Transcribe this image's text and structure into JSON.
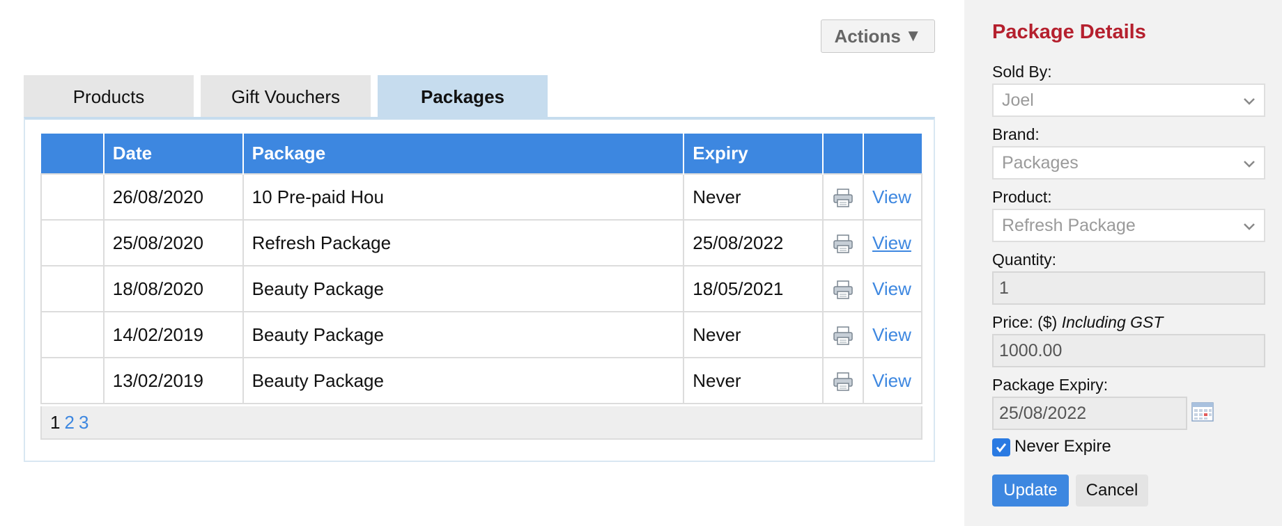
{
  "actions": {
    "label": "Actions",
    "icon": "triangle-down-icon"
  },
  "tabs": [
    {
      "label": "Products",
      "active": false
    },
    {
      "label": "Gift Vouchers",
      "active": false
    },
    {
      "label": "Packages",
      "active": true
    }
  ],
  "table": {
    "headers": [
      "",
      "Date",
      "Package",
      "Expiry",
      "",
      ""
    ],
    "rows": [
      {
        "date": "26/08/2020",
        "package": "10 Pre-paid Hou",
        "expiry": "Never",
        "link": "View"
      },
      {
        "date": "25/08/2020",
        "package": "Refresh Package",
        "expiry": "25/08/2022",
        "link": "View"
      },
      {
        "date": "18/08/2020",
        "package": "Beauty Package",
        "expiry": "18/05/2021",
        "link": "View"
      },
      {
        "date": "14/02/2019",
        "package": "Beauty Package",
        "expiry": "Never",
        "link": "View"
      },
      {
        "date": "13/02/2019",
        "package": "Beauty Package",
        "expiry": "Never",
        "link": "View"
      }
    ]
  },
  "pager": {
    "current": "1",
    "pages": [
      "2",
      "3"
    ]
  },
  "sidebar": {
    "title": "Package Details",
    "sold_by": {
      "label": "Sold By:",
      "value": "Joel"
    },
    "brand": {
      "label": "Brand:",
      "value": "Packages"
    },
    "product": {
      "label": "Product:",
      "value": "Refresh Package"
    },
    "quantity": {
      "label": "Quantity:",
      "value": "1"
    },
    "price": {
      "label": "Price: ($)",
      "label_note": "Including GST",
      "value": "1000.00"
    },
    "expiry": {
      "label": "Package Expiry:",
      "value": "25/08/2022"
    },
    "never_expire": {
      "label": "Never Expire",
      "checked": true
    },
    "update_label": "Update",
    "cancel_label": "Cancel"
  },
  "colors": {
    "accent": "#3d87e0",
    "title": "#b5202e",
    "active_tab": "#c6dcee"
  }
}
